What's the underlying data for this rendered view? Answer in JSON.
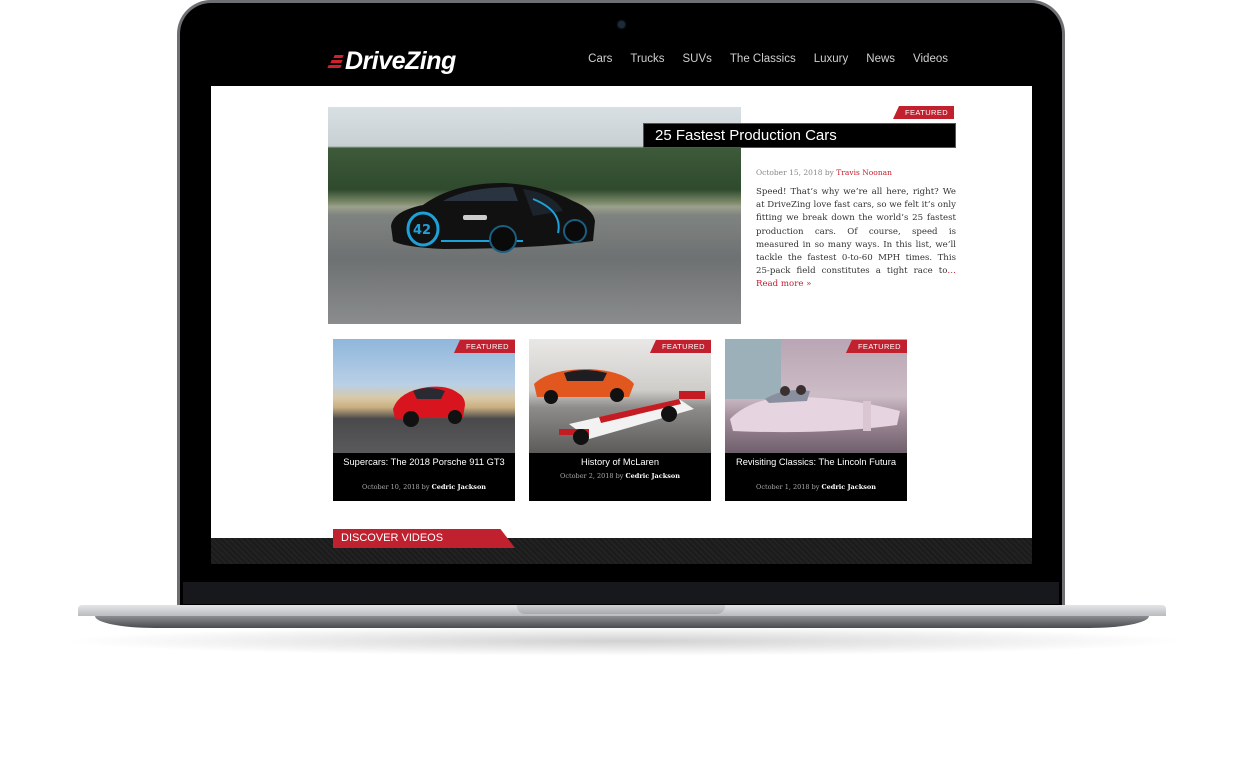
{
  "site": {
    "logo_text": "DriveZing",
    "brand_color": "#c1202e"
  },
  "nav": {
    "items": [
      "Cars",
      "Trucks",
      "SUVs",
      "The Classics",
      "Luxury",
      "News",
      "Videos"
    ]
  },
  "hero": {
    "tag": "FEATURED",
    "title": "25 Fastest Production Cars",
    "date": "October 15, 2018 by ",
    "author": "Travis Noonan",
    "body": "Speed! That’s why we’re all here, right? We at DriveZing love fast cars, so we felt it’s only fitting we break down the world’s 25 fastest production cars. Of course, speed is measured in so many ways. In this list, we’ll tackle the fastest 0-to-60 MPH times. This 25-pack field constitutes a tight race to",
    "read_more": "… Read more »",
    "image_alt": "Black and blue Bugatti Chiron #42 on a test track"
  },
  "cards": [
    {
      "tag": "FEATURED",
      "title": "Supercars: The 2018 Porsche 911 GT3",
      "date": "October 10, 2018 by ",
      "author": "Cedric Jackson",
      "image_alt": "Red Porsche 911 GT3 on a desert road"
    },
    {
      "tag": "FEATURED",
      "title": "History of McLaren",
      "date": "October 2, 2018 by ",
      "author": "Cedric Jackson",
      "image_alt": "Orange McLaren road car and red-white F1 car"
    },
    {
      "tag": "FEATURED",
      "title": "Revisiting Classics: The Lincoln Futura",
      "date": "October 1, 2018 by ",
      "author": "Cedric Jackson",
      "image_alt": "Vintage Lincoln Futura concept car"
    }
  ],
  "videos": {
    "label": "DISCOVER VIDEOS"
  }
}
